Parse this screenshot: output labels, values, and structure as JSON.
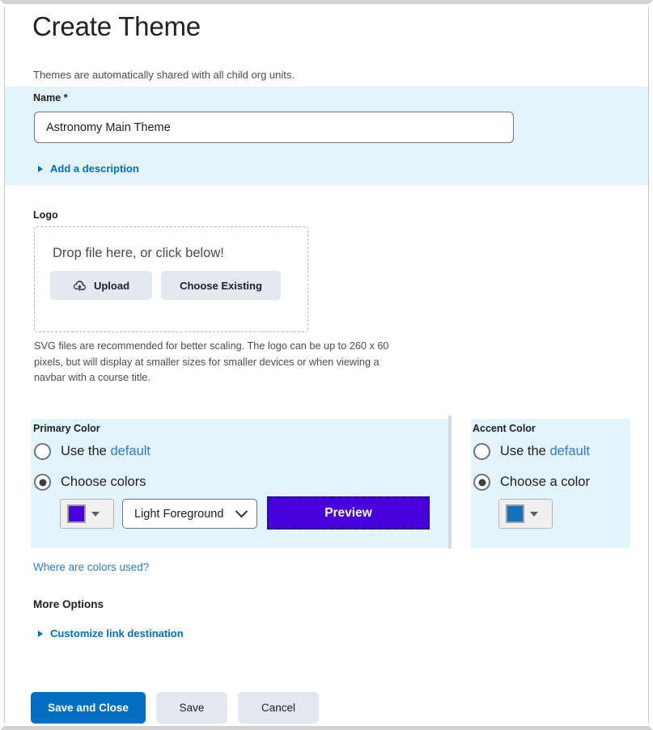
{
  "page": {
    "title": "Create Theme",
    "subtitle": "Themes are automatically shared with all child org units."
  },
  "name_field": {
    "label": "Name *",
    "value": "Astronomy Main Theme",
    "placeholder": "",
    "add_description_label": "Add a description"
  },
  "logo": {
    "label": "Logo",
    "dropzone_text": "Drop file here, or click below!",
    "upload_label": "Upload",
    "upload_icon": "cloud-upload-icon",
    "choose_existing_label": "Choose Existing",
    "help_text": "SVG files are recommended for better scaling. The logo can be up to 260 x 60 pixels, but will display at smaller sizes for smaller devices or when viewing a navbar with a course title."
  },
  "primary_color": {
    "label": "Primary Color",
    "option_default_prefix": "Use the ",
    "option_default_link": "default",
    "option_default_selected": false,
    "option_choose": "Choose colors",
    "option_choose_selected": true,
    "swatch_hex": "#4800db",
    "foreground_select_value": "Light Foreground",
    "preview_label": "Preview",
    "preview_bg_hex": "#4800db"
  },
  "accent_color": {
    "label": "Accent Color",
    "option_default_prefix": "Use the ",
    "option_default_link": "default",
    "option_default_selected": false,
    "option_choose": "Choose a color",
    "option_choose_selected": true,
    "swatch_hex": "#1271bd"
  },
  "links": {
    "where_are_colors_used": "Where are colors used?",
    "more_options_heading": "More Options",
    "customize_link_destination": "Customize link destination"
  },
  "footer": {
    "save_and_close": "Save and Close",
    "save": "Save",
    "cancel": "Cancel"
  },
  "colors": {
    "band_background": "#e4f4fd",
    "link_blue": "#2b7ed1",
    "action_blue": "#006fbf",
    "button_grey": "#e3e9f1"
  }
}
